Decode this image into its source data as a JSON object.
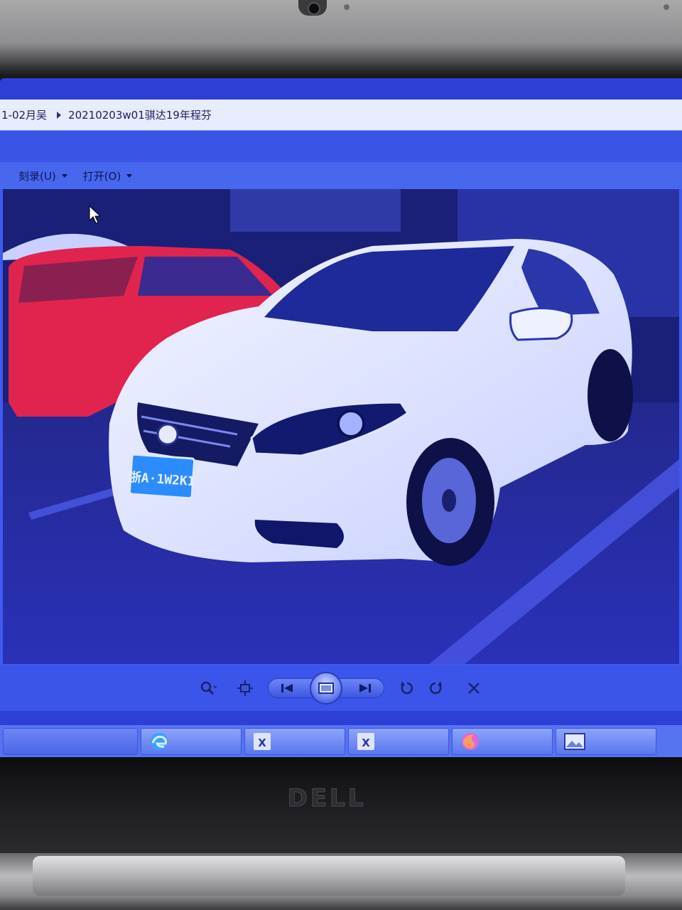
{
  "explorer": {
    "breadcrumb": [
      "1-02月吴",
      "20210203w01骐达19年程芬"
    ],
    "toolbar": {
      "burn_label": "刻录(U)",
      "open_label": "打开(O)"
    }
  },
  "photo": {
    "plate_text": "浙A·1W2K1"
  },
  "viewer_controls": [
    "zoom-icon",
    "fit-actual-size-icon",
    "previous-icon",
    "slideshow-icon",
    "next-icon",
    "rotate-counterclockwise-icon",
    "rotate-clockwise-icon",
    "delete-icon"
  ],
  "taskbar": {
    "items": [
      "edge-icon",
      "excel-icon",
      "excel-icon",
      "firefox-icon",
      "photo-viewer-icon"
    ]
  },
  "device": {
    "logo": "DELL"
  },
  "colors": {
    "screen_tint": "#2e3fd8",
    "toolbar": "#4767ee",
    "laptop_bezel": "#1b1b1f"
  }
}
